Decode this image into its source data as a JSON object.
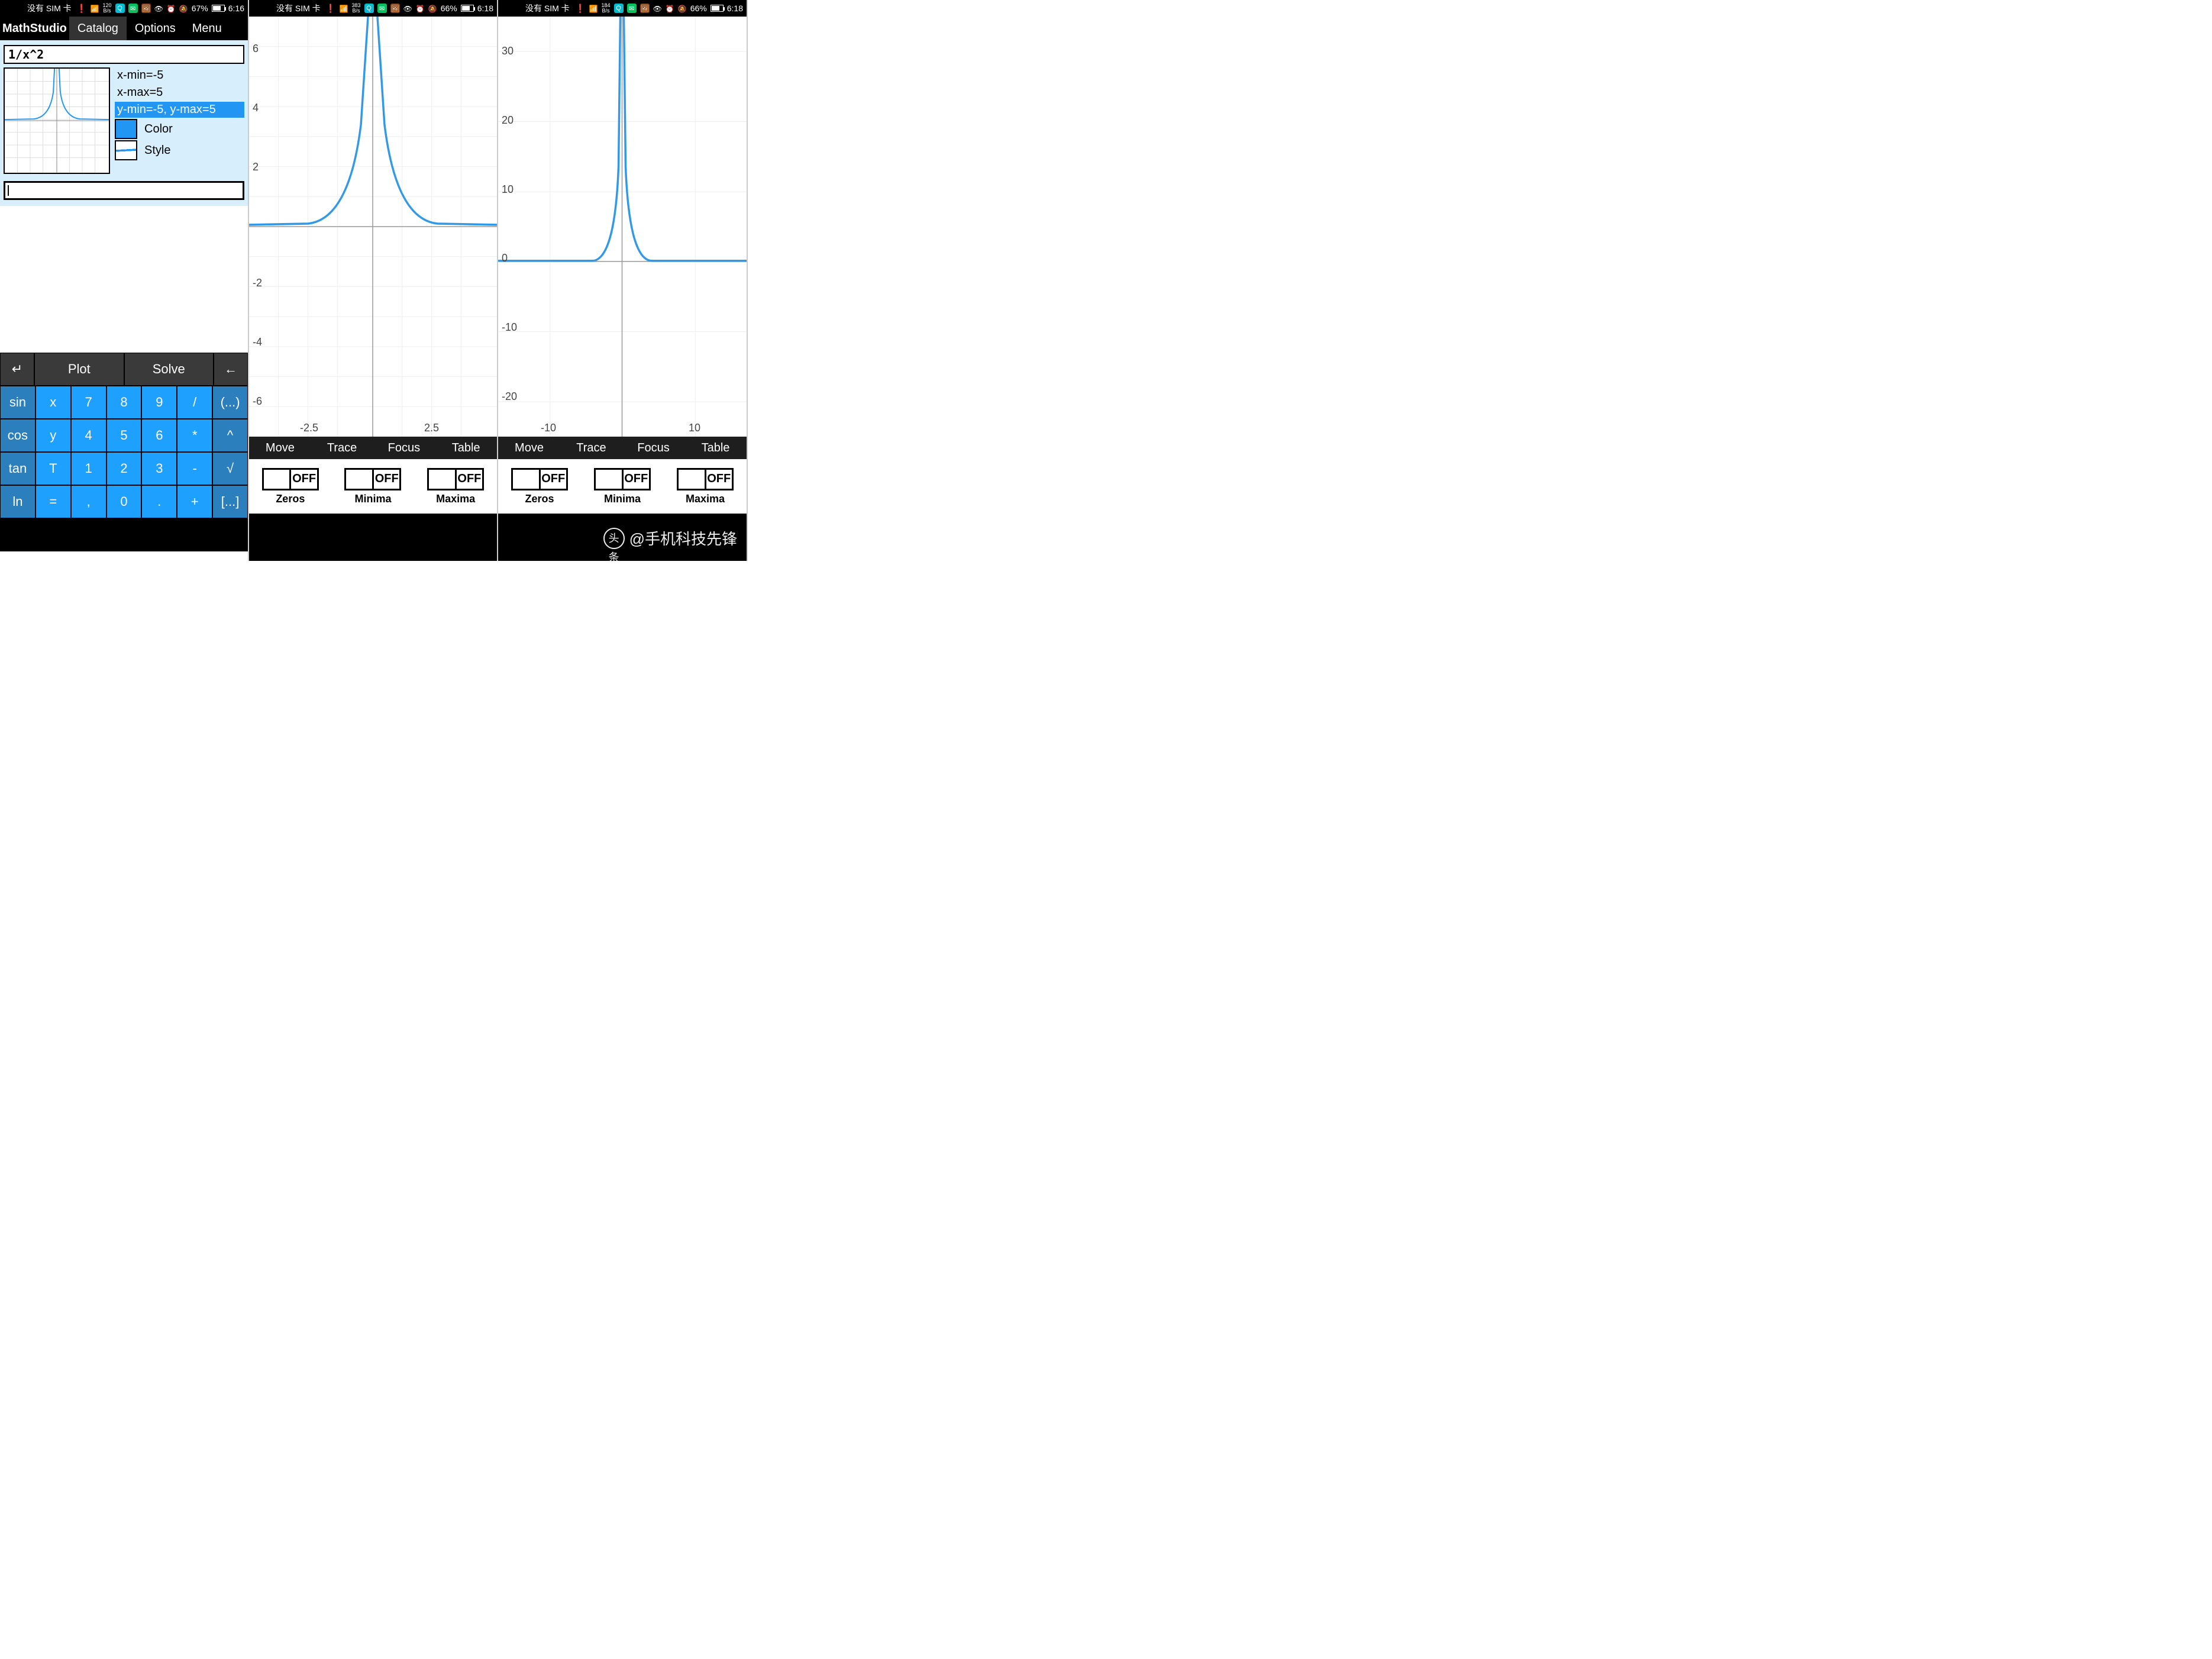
{
  "status": {
    "sim": "没有 SIM 卡",
    "screens": [
      {
        "bs_top": "120",
        "bs_bot": "B/s",
        "battery": "67%",
        "time": "6:16"
      },
      {
        "bs_top": "383",
        "bs_bot": "B/s",
        "battery": "66%",
        "time": "6:18"
      },
      {
        "bs_top": "184",
        "bs_bot": "B/s",
        "battery": "66%",
        "time": "6:18"
      }
    ]
  },
  "pane1": {
    "menu": {
      "brand": "MathStudio",
      "items": [
        "Catalog",
        "Options",
        "Menu"
      ],
      "active": 0
    },
    "expression": "1/x^2",
    "options": {
      "xmin": "x-min=-5",
      "xmax": "x-max=5",
      "yrange": "y-min=-5, y-max=5",
      "color": "Color",
      "style": "Style"
    },
    "keypad": {
      "top": [
        "↵",
        "Plot",
        "Solve",
        "←"
      ],
      "r1": [
        "sin",
        "x",
        "7",
        "8",
        "9",
        "/",
        "(...)"
      ],
      "r2": [
        "cos",
        "y",
        "4",
        "5",
        "6",
        "*",
        "^"
      ],
      "r3": [
        "tan",
        "T",
        "1",
        "2",
        "3",
        "-",
        "√"
      ],
      "r4": [
        "ln",
        "=",
        ",",
        "0",
        ".",
        "+",
        "[...]"
      ]
    }
  },
  "graph_toolbar": [
    "Move",
    "Trace",
    "Focus",
    "Table"
  ],
  "toggles": [
    {
      "state": "OFF",
      "label": "Zeros"
    },
    {
      "state": "OFF",
      "label": "Minima"
    },
    {
      "state": "OFF",
      "label": "Maxima"
    }
  ],
  "watermark": {
    "logo": "头条",
    "text": "@手机科技先锋"
  },
  "chart_data": [
    {
      "type": "line",
      "title": "1/x^2 (pane 2, default window)",
      "series_formula": "y = 1/x^2",
      "xlim": [
        -5,
        5
      ],
      "ylim": [
        -7,
        7
      ],
      "x_ticks": [
        -2.5,
        2.5
      ],
      "y_ticks": [
        -6,
        -4,
        -2,
        2,
        4,
        6
      ],
      "asymptote_x": 0
    },
    {
      "type": "line",
      "title": "1/x^2 (pane 3, zoomed out)",
      "series_formula": "y = 1/x^2",
      "xlim": [
        -17,
        17
      ],
      "ylim": [
        -25,
        35
      ],
      "x_ticks": [
        -10,
        10
      ],
      "y_ticks": [
        -20,
        -10,
        0,
        10,
        20,
        30
      ],
      "asymptote_x": 0
    }
  ]
}
